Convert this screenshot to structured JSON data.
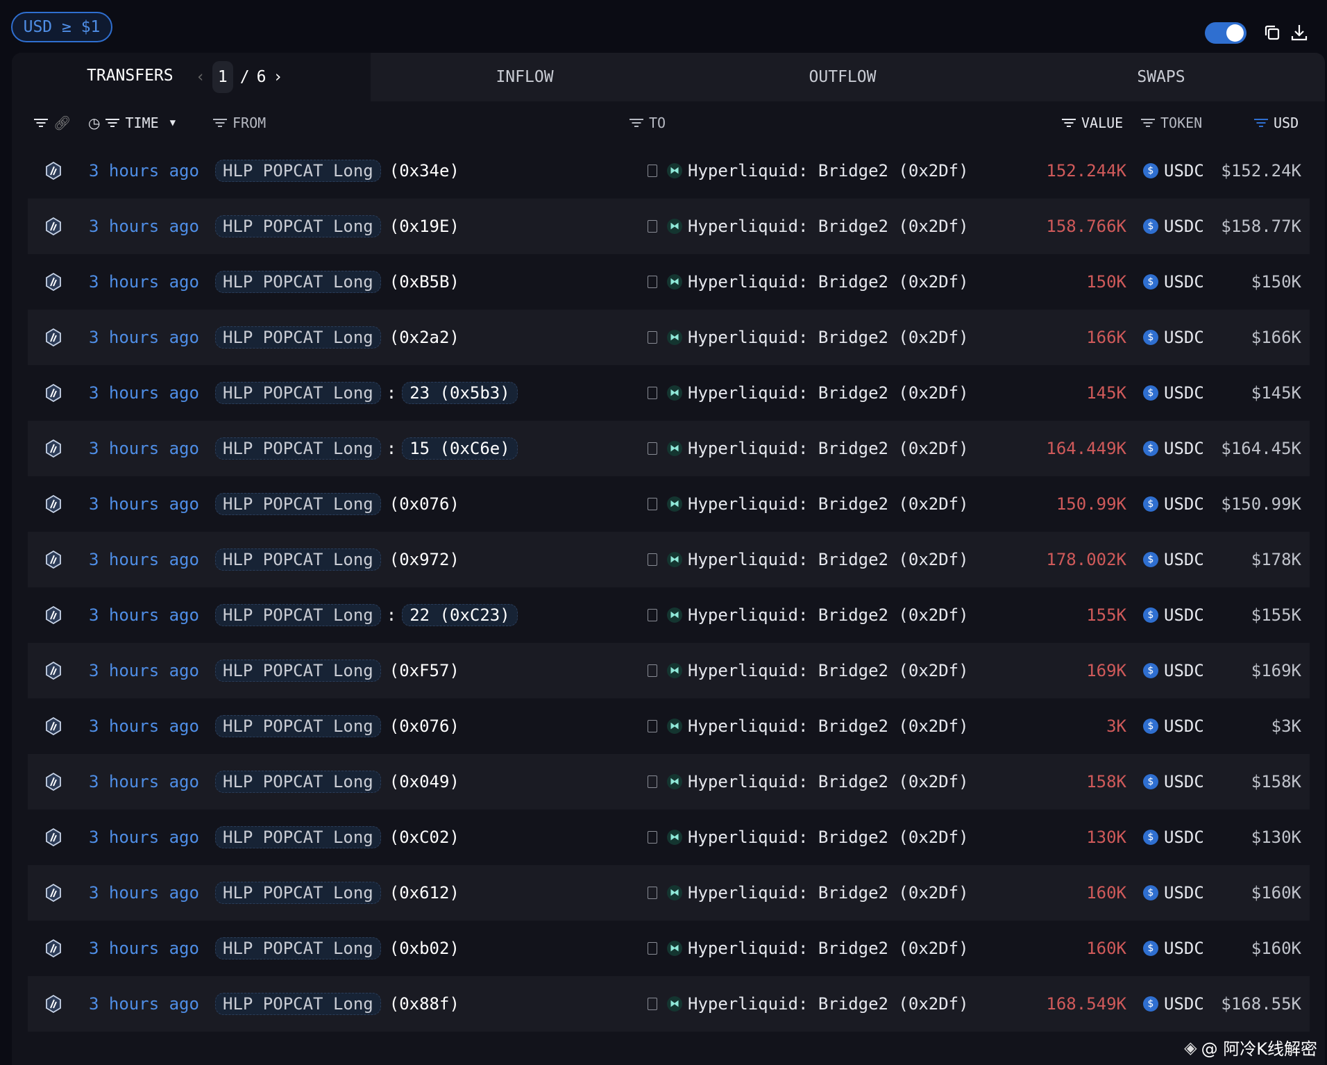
{
  "filter_pill": "USD ≥ $1",
  "toggle_on": true,
  "tabs": {
    "transfers": "TRANSFERS",
    "page_current": "1",
    "page_sep": "/",
    "page_total": "6",
    "inflow": "INFLOW",
    "outflow": "OUTFLOW",
    "swaps": "SWAPS"
  },
  "columns": {
    "time": "TIME",
    "from": "FROM",
    "to": "TO",
    "value": "VALUE",
    "token": "TOKEN",
    "usd": "USD"
  },
  "colors": {
    "accent": "#2f6fd0",
    "value_out": "#d05a5a"
  },
  "rows": [
    {
      "time": "3 hours ago",
      "from_tag": "HLP POPCAT Long",
      "from_num": "",
      "from_addr": "(0x34e)",
      "to": "Hyperliquid: Bridge2 (0x2Df)",
      "value": "152.244K",
      "token": "USDC",
      "usd": "$152.24K"
    },
    {
      "time": "3 hours ago",
      "from_tag": "HLP POPCAT Long",
      "from_num": "",
      "from_addr": "(0x19E)",
      "to": "Hyperliquid: Bridge2 (0x2Df)",
      "value": "158.766K",
      "token": "USDC",
      "usd": "$158.77K"
    },
    {
      "time": "3 hours ago",
      "from_tag": "HLP POPCAT Long",
      "from_num": "",
      "from_addr": "(0xB5B)",
      "to": "Hyperliquid: Bridge2 (0x2Df)",
      "value": "150K",
      "token": "USDC",
      "usd": "$150K"
    },
    {
      "time": "3 hours ago",
      "from_tag": "HLP POPCAT Long",
      "from_num": "",
      "from_addr": "(0x2a2)",
      "to": "Hyperliquid: Bridge2 (0x2Df)",
      "value": "166K",
      "token": "USDC",
      "usd": "$166K"
    },
    {
      "time": "3 hours ago",
      "from_tag": "HLP POPCAT Long",
      "from_num": "23 (0x5b3)",
      "from_addr": "",
      "to": "Hyperliquid: Bridge2 (0x2Df)",
      "value": "145K",
      "token": "USDC",
      "usd": "$145K"
    },
    {
      "time": "3 hours ago",
      "from_tag": "HLP POPCAT Long",
      "from_num": "15 (0xC6e)",
      "from_addr": "",
      "to": "Hyperliquid: Bridge2 (0x2Df)",
      "value": "164.449K",
      "token": "USDC",
      "usd": "$164.45K"
    },
    {
      "time": "3 hours ago",
      "from_tag": "HLP POPCAT Long",
      "from_num": "",
      "from_addr": "(0x076)",
      "to": "Hyperliquid: Bridge2 (0x2Df)",
      "value": "150.99K",
      "token": "USDC",
      "usd": "$150.99K"
    },
    {
      "time": "3 hours ago",
      "from_tag": "HLP POPCAT Long",
      "from_num": "",
      "from_addr": "(0x972)",
      "to": "Hyperliquid: Bridge2 (0x2Df)",
      "value": "178.002K",
      "token": "USDC",
      "usd": "$178K"
    },
    {
      "time": "3 hours ago",
      "from_tag": "HLP POPCAT Long",
      "from_num": "22 (0xC23)",
      "from_addr": "",
      "to": "Hyperliquid: Bridge2 (0x2Df)",
      "value": "155K",
      "token": "USDC",
      "usd": "$155K"
    },
    {
      "time": "3 hours ago",
      "from_tag": "HLP POPCAT Long",
      "from_num": "",
      "from_addr": "(0xF57)",
      "to": "Hyperliquid: Bridge2 (0x2Df)",
      "value": "169K",
      "token": "USDC",
      "usd": "$169K"
    },
    {
      "time": "3 hours ago",
      "from_tag": "HLP POPCAT Long",
      "from_num": "",
      "from_addr": "(0x076)",
      "to": "Hyperliquid: Bridge2 (0x2Df)",
      "value": "3K",
      "token": "USDC",
      "usd": "$3K"
    },
    {
      "time": "3 hours ago",
      "from_tag": "HLP POPCAT Long",
      "from_num": "",
      "from_addr": "(0x049)",
      "to": "Hyperliquid: Bridge2 (0x2Df)",
      "value": "158K",
      "token": "USDC",
      "usd": "$158K"
    },
    {
      "time": "3 hours ago",
      "from_tag": "HLP POPCAT Long",
      "from_num": "",
      "from_addr": "(0xC02)",
      "to": "Hyperliquid: Bridge2 (0x2Df)",
      "value": "130K",
      "token": "USDC",
      "usd": "$130K"
    },
    {
      "time": "3 hours ago",
      "from_tag": "HLP POPCAT Long",
      "from_num": "",
      "from_addr": "(0x612)",
      "to": "Hyperliquid: Bridge2 (0x2Df)",
      "value": "160K",
      "token": "USDC",
      "usd": "$160K"
    },
    {
      "time": "3 hours ago",
      "from_tag": "HLP POPCAT Long",
      "from_num": "",
      "from_addr": "(0xb02)",
      "to": "Hyperliquid: Bridge2 (0x2Df)",
      "value": "160K",
      "token": "USDC",
      "usd": "$160K"
    },
    {
      "time": "3 hours ago",
      "from_tag": "HLP POPCAT Long",
      "from_num": "",
      "from_addr": "(0x88f)",
      "to": "Hyperliquid: Bridge2 (0x2Df)",
      "value": "168.549K",
      "token": "USDC",
      "usd": "$168.55K"
    }
  ],
  "watermark": "@ 阿冷K线解密"
}
